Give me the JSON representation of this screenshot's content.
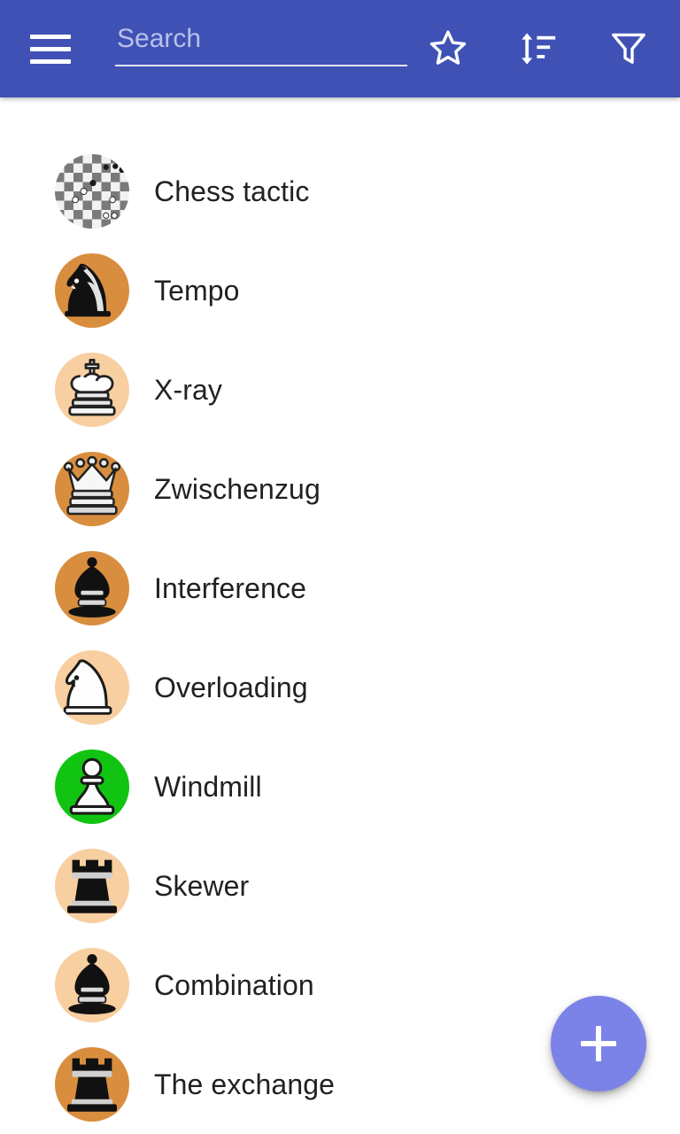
{
  "appbar": {
    "background_color": "#3F51B5",
    "menu_icon": "hamburger-menu-icon",
    "search": {
      "placeholder": "Search",
      "value": ""
    },
    "actions": [
      {
        "icon": "star-outline-icon",
        "label": "Favorites"
      },
      {
        "icon": "sort-icon",
        "label": "Sort"
      },
      {
        "icon": "filter-funnel-icon",
        "label": "Filter"
      }
    ]
  },
  "list": {
    "items": [
      {
        "label": "Chess tactic",
        "avatar_icon": "chessboard-icon",
        "avatar_color": "#FFFFFF"
      },
      {
        "label": "Tempo",
        "avatar_icon": "black-knight-icon",
        "avatar_color": "#D98E3F"
      },
      {
        "label": "X-ray",
        "avatar_icon": "white-king-icon",
        "avatar_color": "#F8CFA0"
      },
      {
        "label": "Zwischenzug",
        "avatar_icon": "white-queen-icon",
        "avatar_color": "#D98E3F"
      },
      {
        "label": "Interference",
        "avatar_icon": "black-bishop-icon",
        "avatar_color": "#D98E3F"
      },
      {
        "label": "Overloading",
        "avatar_icon": "white-knight-icon",
        "avatar_color": "#F8CFA0"
      },
      {
        "label": "Windmill",
        "avatar_icon": "white-pawn-icon",
        "avatar_color": "#12C412"
      },
      {
        "label": "Skewer",
        "avatar_icon": "black-rook-icon",
        "avatar_color": "#F8CFA0"
      },
      {
        "label": "Combination",
        "avatar_icon": "black-bishop-icon",
        "avatar_color": "#F8CFA0"
      },
      {
        "label": "The exchange",
        "avatar_icon": "black-rook-icon",
        "avatar_color": "#D98E3F"
      }
    ]
  },
  "fab": {
    "icon": "plus-icon",
    "label": "Add",
    "color": "#7B82E8"
  }
}
